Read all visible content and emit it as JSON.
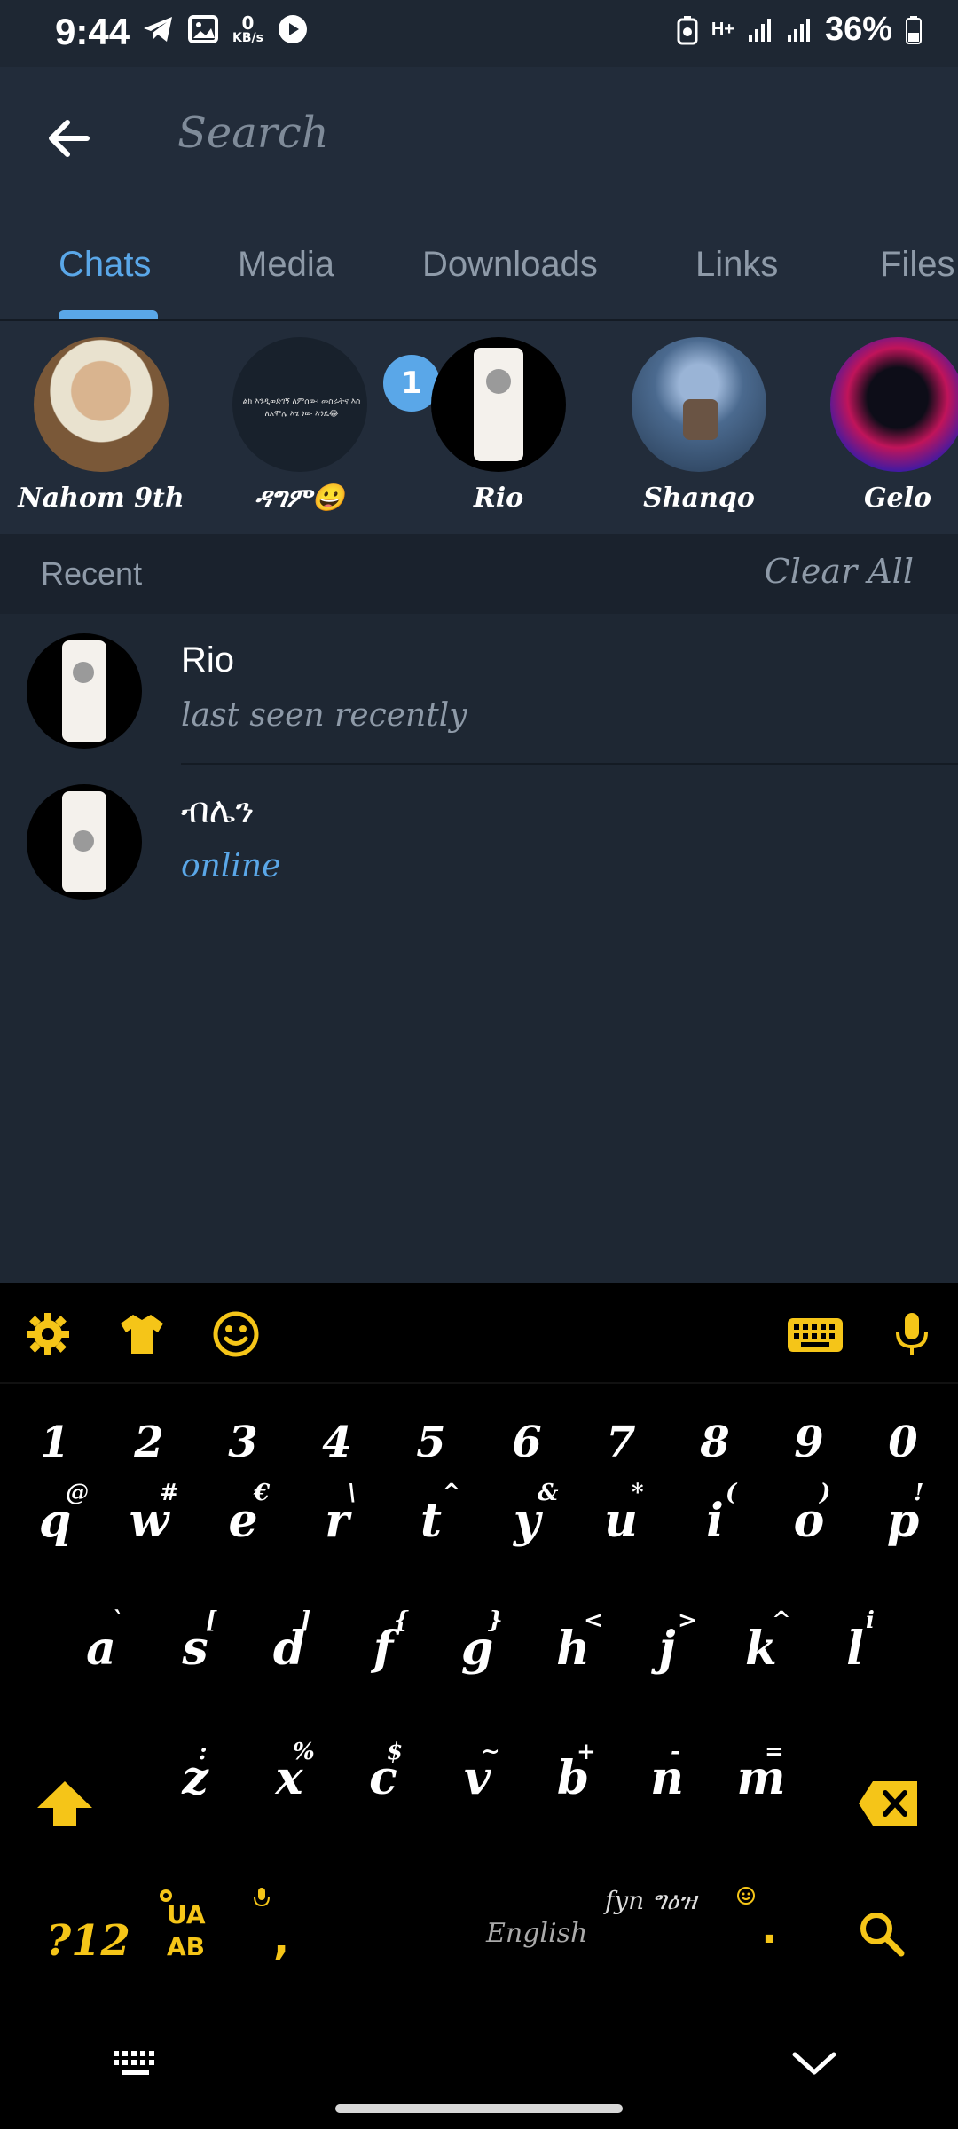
{
  "status_bar": {
    "time": "9:44",
    "speed_value": "0",
    "speed_unit": "KB/s",
    "network": "H+",
    "battery": "36%"
  },
  "header": {
    "search_placeholder": "Search"
  },
  "tabs": [
    {
      "label": "Chats",
      "active": true
    },
    {
      "label": "Media",
      "active": false
    },
    {
      "label": "Downloads",
      "active": false
    },
    {
      "label": "Links",
      "active": false
    },
    {
      "label": "Files",
      "active": false
    }
  ],
  "stories": [
    {
      "name": "Nahom 9th"
    },
    {
      "name": "ዳግም😀",
      "badge": "1",
      "preview_line1": "ልክ እንዲወድገኝ ለምሰው፡ መስራትና እሰ",
      "preview_line2": "ለአሞሌ እሄ ነው እንዴ😂"
    },
    {
      "name": "Rio"
    },
    {
      "name": "Shanqo"
    },
    {
      "name": "Gelo"
    }
  ],
  "recent": {
    "label": "Recent",
    "clear_label": "Clear All",
    "items": [
      {
        "name": "Rio",
        "status": "last seen recently"
      },
      {
        "name": "ብሌን",
        "status": "online"
      }
    ]
  },
  "keyboard": {
    "numbers": [
      "1",
      "2",
      "3",
      "4",
      "5",
      "6",
      "7",
      "8",
      "9",
      "0"
    ],
    "row1": [
      {
        "key": "q",
        "hint": "@"
      },
      {
        "key": "w",
        "hint": "#"
      },
      {
        "key": "e",
        "hint": "€"
      },
      {
        "key": "r",
        "hint": "\\"
      },
      {
        "key": "t",
        "hint": "^"
      },
      {
        "key": "y",
        "hint": "&"
      },
      {
        "key": "u",
        "hint": "*"
      },
      {
        "key": "i",
        "hint": "("
      },
      {
        "key": "o",
        "hint": ")"
      },
      {
        "key": "p",
        "hint": "!"
      }
    ],
    "row2": [
      {
        "key": "a",
        "hint": "`"
      },
      {
        "key": "s",
        "hint": "["
      },
      {
        "key": "d",
        "hint": "]"
      },
      {
        "key": "f",
        "hint": "{"
      },
      {
        "key": "g",
        "hint": "}"
      },
      {
        "key": "h",
        "hint": "<"
      },
      {
        "key": "j",
        "hint": ">"
      },
      {
        "key": "k",
        "hint": "^"
      },
      {
        "key": "l",
        "hint": "i"
      }
    ],
    "row3": [
      {
        "key": "z",
        "hint": ":"
      },
      {
        "key": "x",
        "hint": "%"
      },
      {
        "key": "c",
        "hint": "$"
      },
      {
        "key": "v",
        "hint": "~"
      },
      {
        "key": "b",
        "hint": "+"
      },
      {
        "key": "n",
        "hint": "-"
      },
      {
        "key": "m",
        "hint": "="
      }
    ],
    "symbols_label": "?12",
    "lang_top": "UA",
    "lang_bottom": "AB",
    "comma": ",",
    "space_label": "English",
    "ethiopic_label": "fyn ግዕዝ",
    "period": ".",
    "accent_color": "#f5c518"
  }
}
